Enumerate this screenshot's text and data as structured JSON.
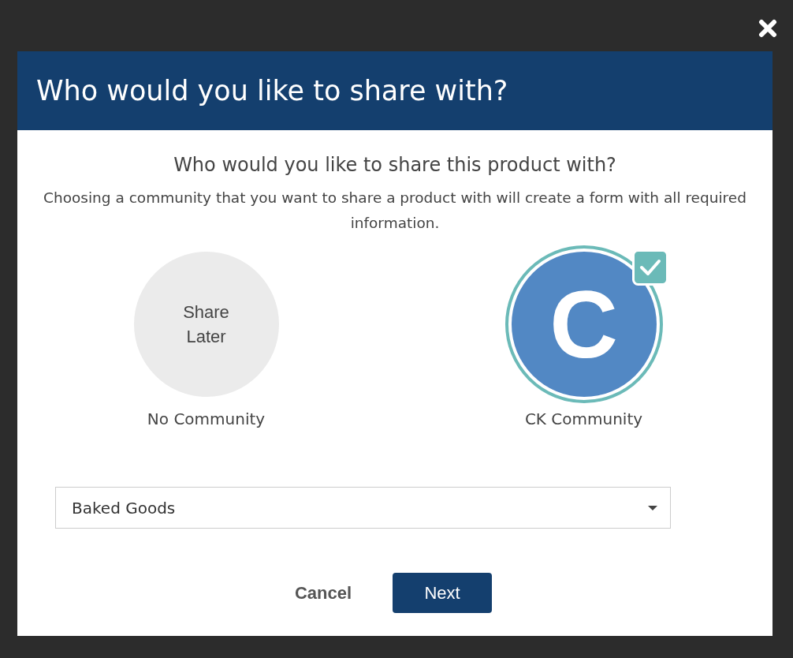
{
  "dialog": {
    "title": "Who would you like to share with?",
    "heading": "Who would you like to share this product with?",
    "description": "Choosing a community that you want to share a product with will create a form with all required information.",
    "options": [
      {
        "kind": "placeholder",
        "text": "Share Later",
        "label": "No Community",
        "selected": false
      },
      {
        "kind": "avatar",
        "initial": "C",
        "label": "CK Community",
        "selected": true
      }
    ],
    "category_select": {
      "value": "Baked Goods"
    },
    "buttons": {
      "cancel": "Cancel",
      "next": "Next"
    }
  }
}
